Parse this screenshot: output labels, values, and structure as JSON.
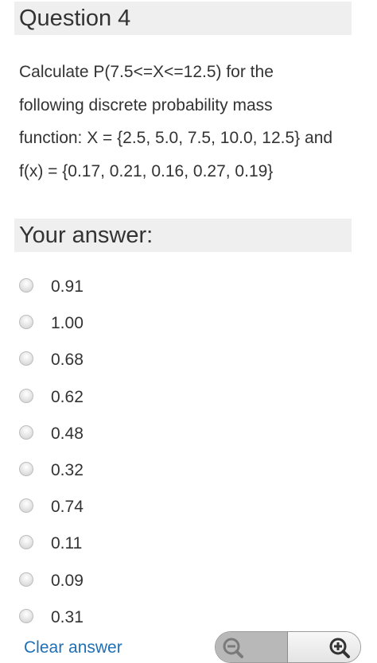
{
  "question": {
    "title": "Question 4",
    "lines": [
      "Calculate P(7.5<=X<=12.5) for the",
      "following discrete probability mass",
      "function: X = {2.5, 5.0, 7.5, 10.0, 12.5} and",
      "f(x) = {0.17, 0.21, 0.16, 0.27, 0.19}"
    ]
  },
  "answer": {
    "title": "Your answer:",
    "options": [
      "0.91",
      "1.00",
      "0.68",
      "0.62",
      "0.48",
      "0.32",
      "0.74",
      "0.11",
      "0.09",
      "0.31"
    ],
    "clear_label": "Clear answer"
  },
  "zoom": {
    "out_icon": "zoom-out-icon",
    "in_icon": "zoom-in-icon"
  },
  "colors": {
    "link": "#1f6fb5",
    "header_bg": "#efefef",
    "text": "#333333"
  }
}
